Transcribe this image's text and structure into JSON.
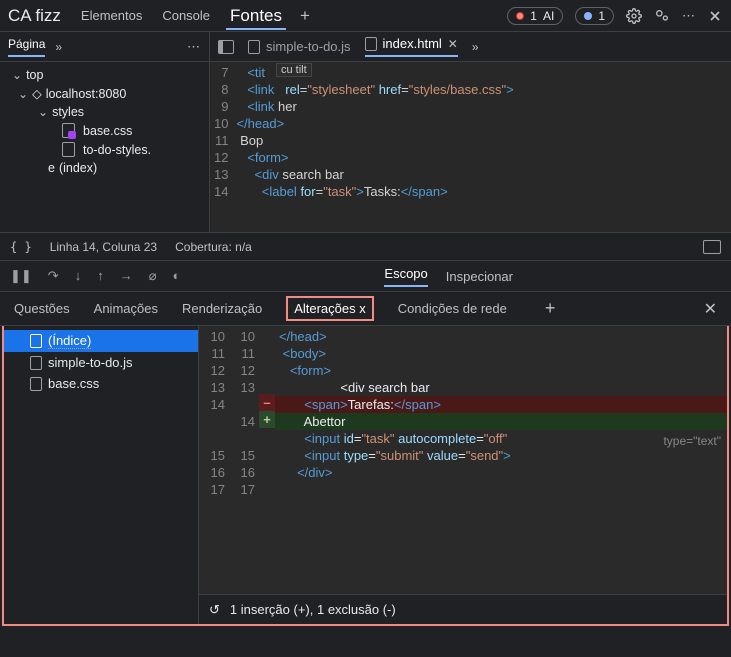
{
  "topbar": {
    "brand": "CA fizz",
    "tabs": [
      "Elementos",
      "Console",
      "Fontes"
    ],
    "active_tab": 2,
    "plus": "+",
    "pill1_count": "1",
    "pill1_label": "AI",
    "pill2_count": "1"
  },
  "sidebar": {
    "tab": "Página",
    "tree": {
      "top": "top",
      "host": "localhost:8080",
      "styles": "styles",
      "file_css": "base.css",
      "file_styles": "to-do-styles.",
      "index": "(index)",
      "e_prefix": "e "
    }
  },
  "editor": {
    "tabs": [
      {
        "name": "simple-to-do.js",
        "active": false,
        "close": false
      },
      {
        "name": "index.html",
        "active": true,
        "close": true
      }
    ],
    "gutter": [
      "7",
      "8",
      "9",
      "10",
      "11",
      "12",
      "13",
      "14"
    ],
    "hint1": "cu tilt",
    "code_lines": [
      {
        "indent": "   ",
        "parts": [
          {
            "c": "tag",
            "t": "<tit"
          }
        ]
      },
      {
        "indent": "   ",
        "parts": [
          {
            "c": "tag",
            "t": "<link"
          },
          {
            "c": "txt",
            "t": "   "
          },
          {
            "c": "attr",
            "t": "rel"
          },
          {
            "c": "txt",
            "t": "="
          },
          {
            "c": "str",
            "t": "\"stylesheet\""
          },
          {
            "c": "txt",
            "t": " "
          },
          {
            "c": "attr",
            "t": "href"
          },
          {
            "c": "txt",
            "t": "="
          },
          {
            "c": "str",
            "t": "\"styles/base.css\""
          },
          {
            "c": "tag",
            "t": ">"
          }
        ]
      },
      {
        "indent": "   ",
        "parts": [
          {
            "c": "tag",
            "t": "<link "
          },
          {
            "c": "txt",
            "t": "her"
          }
        ]
      },
      {
        "indent": "",
        "parts": [
          {
            "c": "tag",
            "t": "</head>"
          }
        ]
      },
      {
        "indent": " ",
        "parts": [
          {
            "c": "txt",
            "t": "Bop"
          }
        ]
      },
      {
        "indent": "   ",
        "parts": [
          {
            "c": "tag",
            "t": "<form>"
          }
        ]
      },
      {
        "indent": "     ",
        "parts": [
          {
            "c": "tag",
            "t": "<div "
          },
          {
            "c": "txt",
            "t": "search bar"
          }
        ]
      },
      {
        "indent": "       ",
        "parts": [
          {
            "c": "tag",
            "t": "<label "
          },
          {
            "c": "attr",
            "t": "for"
          },
          {
            "c": "txt",
            "t": "="
          },
          {
            "c": "str",
            "t": "\"task\""
          },
          {
            "c": "tag",
            "t": ">"
          },
          {
            "c": "txt",
            "t": "Tasks:"
          },
          {
            "c": "tag",
            "t": "</span>"
          }
        ]
      }
    ]
  },
  "status": {
    "braces": "{ }",
    "pos": "Linha 14, Coluna 23",
    "cov": "Cobertura: n/a"
  },
  "dbg": {
    "tabs": [
      "Escopo",
      "Inspecionar"
    ],
    "active": 0
  },
  "drawer": {
    "tabs": [
      "Questões",
      "Animações",
      "Renderização",
      "Alterações x",
      "Condições de rede"
    ],
    "active": 3,
    "files": [
      {
        "name": "(Índice)",
        "sel": true,
        "dotted": true
      },
      {
        "name": "simple-to-do.js",
        "sel": false
      },
      {
        "name": "base.css",
        "sel": false
      }
    ],
    "g1": [
      "10",
      "11",
      "12",
      "13",
      "14",
      "",
      "",
      "15",
      "16",
      "17"
    ],
    "g2": [
      "10",
      "11",
      "12",
      "13",
      "",
      "14",
      "",
      "15",
      "16",
      "17"
    ],
    "sign": [
      "",
      "",
      "",
      "",
      "–",
      "+",
      "",
      "",
      "",
      ""
    ],
    "side_label": "type=\"text\"",
    "lines": [
      {
        "cls": "",
        "html": "<span class='tag'>&lt;/head&gt;</span>"
      },
      {
        "cls": "",
        "html": " <span class='tag'>&lt;body&gt;</span>"
      },
      {
        "cls": "",
        "html": "   <span class='tag'>&lt;form&gt;</span>"
      },
      {
        "cls": "",
        "html": "                 &lt;div search bar"
      },
      {
        "cls": "removed",
        "html": "       <span class='tag'>&lt;span&gt;</span>Tarefas:<span class='tag'>&lt;/span&gt;</span>"
      },
      {
        "cls": "added",
        "html": "       Abettor"
      },
      {
        "cls": "",
        "html": "       <span class='tag'>&lt;input</span> <span class='attr'>id</span>=<span class='str'>\"task\"</span> <span class='attr'>autocomplete</span>=<span class='str'>\"off\"</span>"
      },
      {
        "cls": "",
        "html": "       <span class='tag'>&lt;input</span> <span class='attr'>type</span>=<span class='str'>\"submit\"</span> <span class='attr'>value</span>=<span class='str'>\"send\"</span><span class='tag'>&gt;</span>"
      },
      {
        "cls": "",
        "html": "     <span class='tag'>&lt;/div&gt;</span>"
      },
      {
        "cls": "",
        "html": ""
      }
    ],
    "status": "1 inserção (+), 1 exclusão (-)"
  }
}
